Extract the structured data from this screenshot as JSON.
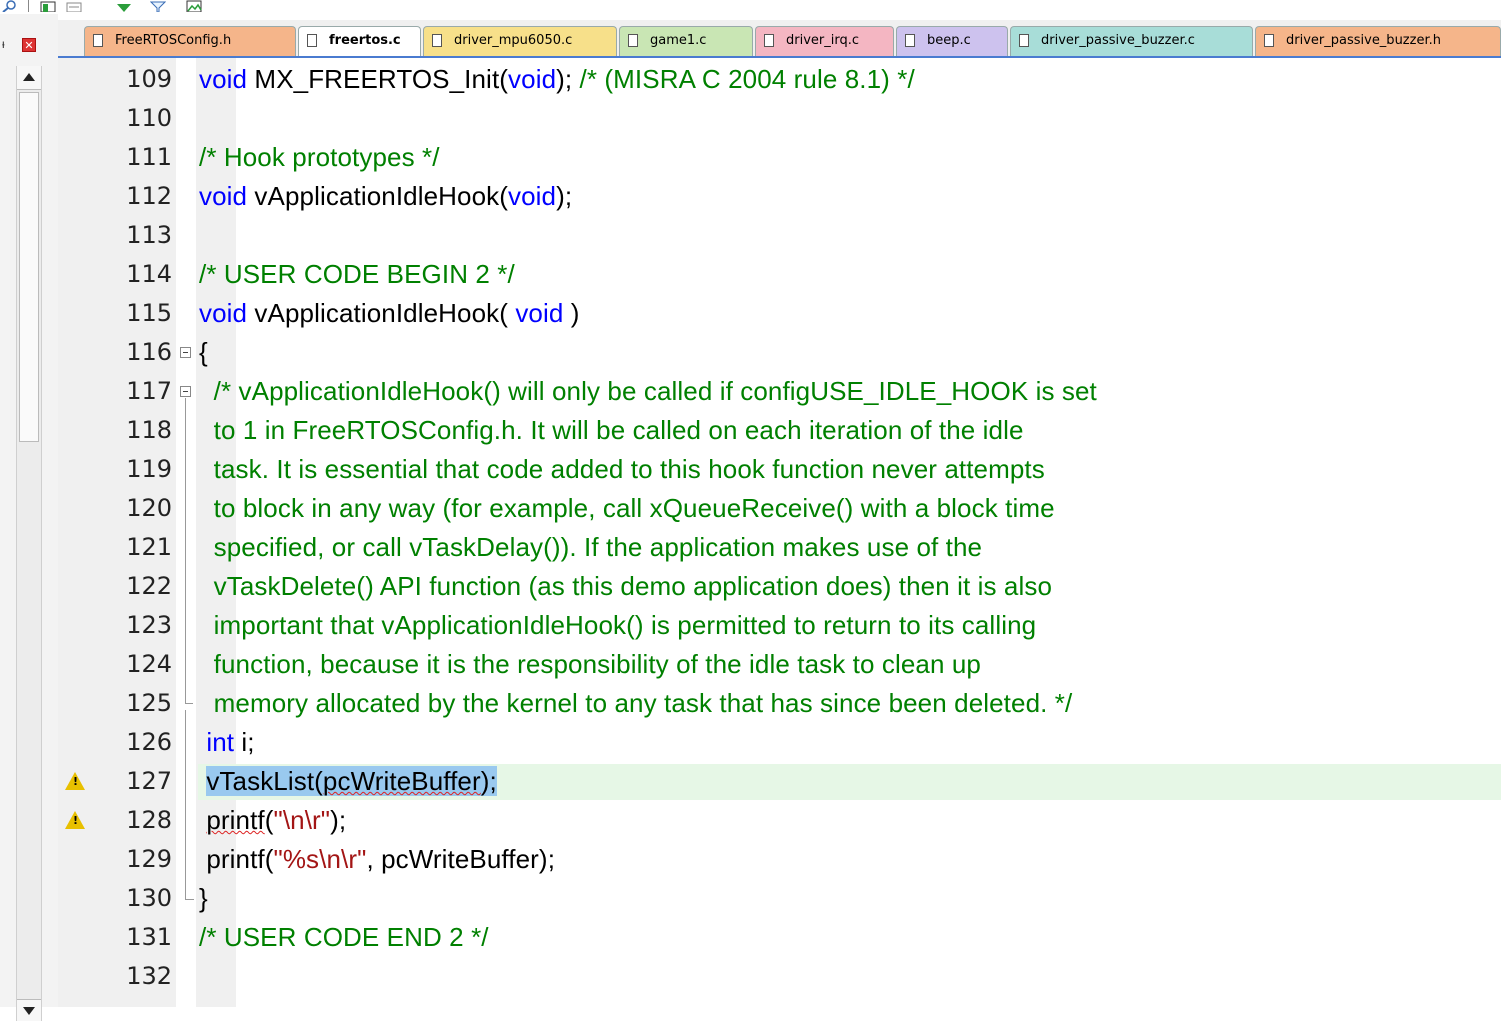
{
  "toolbar": {
    "icons": [
      "search-icon",
      "new-window-icon",
      "restore-icon",
      "download-icon",
      "filter-icon",
      "image-icon"
    ]
  },
  "panel": {
    "pin": "ᵼ",
    "close": "✕"
  },
  "tabs": [
    {
      "label": "FreeRTOSConfig.h",
      "color": "#f5b58a",
      "active": false
    },
    {
      "label": "freertos.c",
      "color": "#ffffff",
      "active": true
    },
    {
      "label": "driver_mpu6050.c",
      "color": "#f7e08a",
      "active": false
    },
    {
      "label": "game1.c",
      "color": "#c9e6b4",
      "active": false
    },
    {
      "label": "driver_irq.c",
      "color": "#f4b6c2",
      "active": false
    },
    {
      "label": "beep.c",
      "color": "#cdc2ee",
      "active": false
    },
    {
      "label": "driver_passive_buzzer.c",
      "color": "#a8ddd8",
      "active": false
    },
    {
      "label": "driver_passive_buzzer.h",
      "color": "#f5b58a",
      "active": false
    }
  ],
  "lines": [
    {
      "num": "109",
      "code": "void MX_FREERTOS_Init(void); /* (MISRA C 2004 rule 8.1) */"
    },
    {
      "num": "110",
      "code": ""
    },
    {
      "num": "111",
      "code": "/* Hook prototypes */"
    },
    {
      "num": "112",
      "code": "void vApplicationIdleHook(void);"
    },
    {
      "num": "113",
      "code": ""
    },
    {
      "num": "114",
      "code": "/* USER CODE BEGIN 2 */"
    },
    {
      "num": "115",
      "code": "void vApplicationIdleHook( void )"
    },
    {
      "num": "116",
      "code": "{"
    },
    {
      "num": "117",
      "code": "  /* vApplicationIdleHook() will only be called if configUSE_IDLE_HOOK is set"
    },
    {
      "num": "118",
      "code": "  to 1 in FreeRTOSConfig.h. It will be called on each iteration of the idle"
    },
    {
      "num": "119",
      "code": "  task. It is essential that code added to this hook function never attempts"
    },
    {
      "num": "120",
      "code": "  to block in any way (for example, call xQueueReceive() with a block time"
    },
    {
      "num": "121",
      "code": "  specified, or call vTaskDelay()). If the application makes use of the"
    },
    {
      "num": "122",
      "code": "  vTaskDelete() API function (as this demo application does) then it is also"
    },
    {
      "num": "123",
      "code": "  important that vApplicationIdleHook() is permitted to return to its calling"
    },
    {
      "num": "124",
      "code": "  function, because it is the responsibility of the idle task to clean up"
    },
    {
      "num": "125",
      "code": "  memory allocated by the kernel to any task that has since been deleted. */"
    },
    {
      "num": "126",
      "code": " int i;"
    },
    {
      "num": "127",
      "code": " vTaskList(pcWriteBuffer);",
      "warning": true
    },
    {
      "num": "128",
      "code": " printf(\"\\n\\r\");",
      "warning": true
    },
    {
      "num": "129",
      "code": " printf(\"%s\\n\\r\", pcWriteBuffer);"
    },
    {
      "num": "130",
      "code": "}"
    },
    {
      "num": "131",
      "code": "/* USER CODE END 2 */"
    },
    {
      "num": "132",
      "code": ""
    }
  ]
}
